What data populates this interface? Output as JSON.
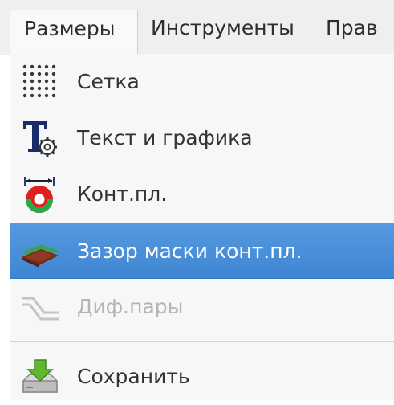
{
  "menubar": {
    "items": [
      {
        "label": "Размеры"
      },
      {
        "label": "Инструменты"
      },
      {
        "label": "Прав"
      }
    ]
  },
  "dropdown": {
    "items": [
      {
        "label": "Сетка",
        "icon": "grid-dots-icon",
        "state": "normal"
      },
      {
        "label": "Текст и графика",
        "icon": "text-settings-icon",
        "state": "normal"
      },
      {
        "label": "Конт.пл.",
        "icon": "pad-icon",
        "state": "normal"
      },
      {
        "label": "Зазор маски конт.пл.",
        "icon": "mask-layers-icon",
        "state": "highlighted"
      },
      {
        "label": "Диф.пары",
        "icon": "diff-pair-icon",
        "state": "disabled"
      },
      {
        "label": "Сохранить",
        "icon": "save-icon",
        "state": "normal"
      }
    ]
  },
  "colors": {
    "highlight": "#4a90d9",
    "menubar_bg": "#efefef",
    "menu_bg": "#f7f7f7",
    "disabled_text": "#b5b5b5"
  }
}
